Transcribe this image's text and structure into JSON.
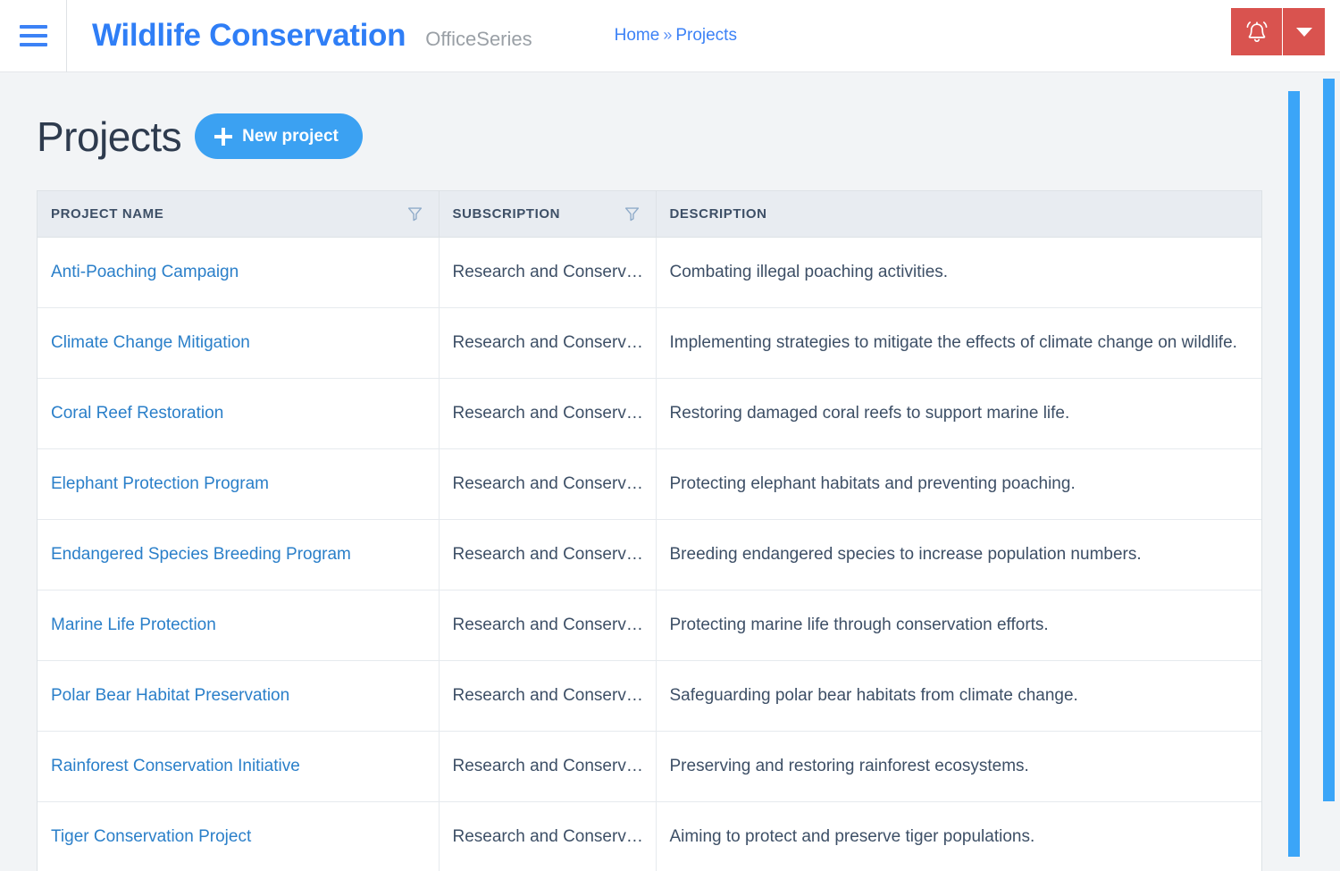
{
  "navbar": {
    "menu_icon": "hamburger-icon",
    "brand_title": "Wildlife Conservation",
    "brand_subtitle": "OfficeSeries",
    "breadcrumb": {
      "home": "Home",
      "separator": "»",
      "current": "Projects"
    },
    "actions": {
      "notifications_icon": "bell-icon",
      "dropdown_icon": "caret-down-icon",
      "accent_color": "#d9534f"
    }
  },
  "main": {
    "title": "Projects",
    "new_project_button": {
      "label": "New project",
      "icon": "plus-icon",
      "color": "#3ba1f2"
    },
    "table": {
      "columns": [
        {
          "label": "PROJECT NAME",
          "filterable": true,
          "filter_icon": "filter-funnel-icon"
        },
        {
          "label": "SUBSCRIPTION",
          "filterable": true,
          "filter_icon": "filter-funnel-icon"
        },
        {
          "label": "DESCRIPTION",
          "filterable": false,
          "filter_icon": ""
        }
      ],
      "rows": [
        {
          "name": "Anti-Poaching Campaign",
          "subscription": "Research and Conserv…",
          "description": "Combating illegal poaching activities."
        },
        {
          "name": "Climate Change Mitigation",
          "subscription": "Research and Conserv…",
          "description": "Implementing strategies to mitigate the effects of climate change on wildlife."
        },
        {
          "name": "Coral Reef Restoration",
          "subscription": "Research and Conserv…",
          "description": "Restoring damaged coral reefs to support marine life."
        },
        {
          "name": "Elephant Protection Program",
          "subscription": "Research and Conserv…",
          "description": "Protecting elephant habitats and preventing poaching."
        },
        {
          "name": "Endangered Species Breeding Program",
          "subscription": "Research and Conserv…",
          "description": "Breeding endangered species to increase population numbers."
        },
        {
          "name": "Marine Life Protection",
          "subscription": "Research and Conserv…",
          "description": "Protecting marine life through conservation efforts."
        },
        {
          "name": "Polar Bear Habitat Preservation",
          "subscription": "Research and Conserv…",
          "description": "Safeguarding polar bear habitats from climate change."
        },
        {
          "name": "Rainforest Conservation Initiative",
          "subscription": "Research and Conserv…",
          "description": "Preserving and restoring rainforest ecosystems."
        },
        {
          "name": "Tiger Conservation Project",
          "subscription": "Research and Conserv…",
          "description": "Aiming to protect and preserve tiger populations."
        }
      ]
    }
  },
  "scrollbars": {
    "inner_thumb_color": "#3ba5f8",
    "outer_thumb_color": "#3ba5f8"
  }
}
